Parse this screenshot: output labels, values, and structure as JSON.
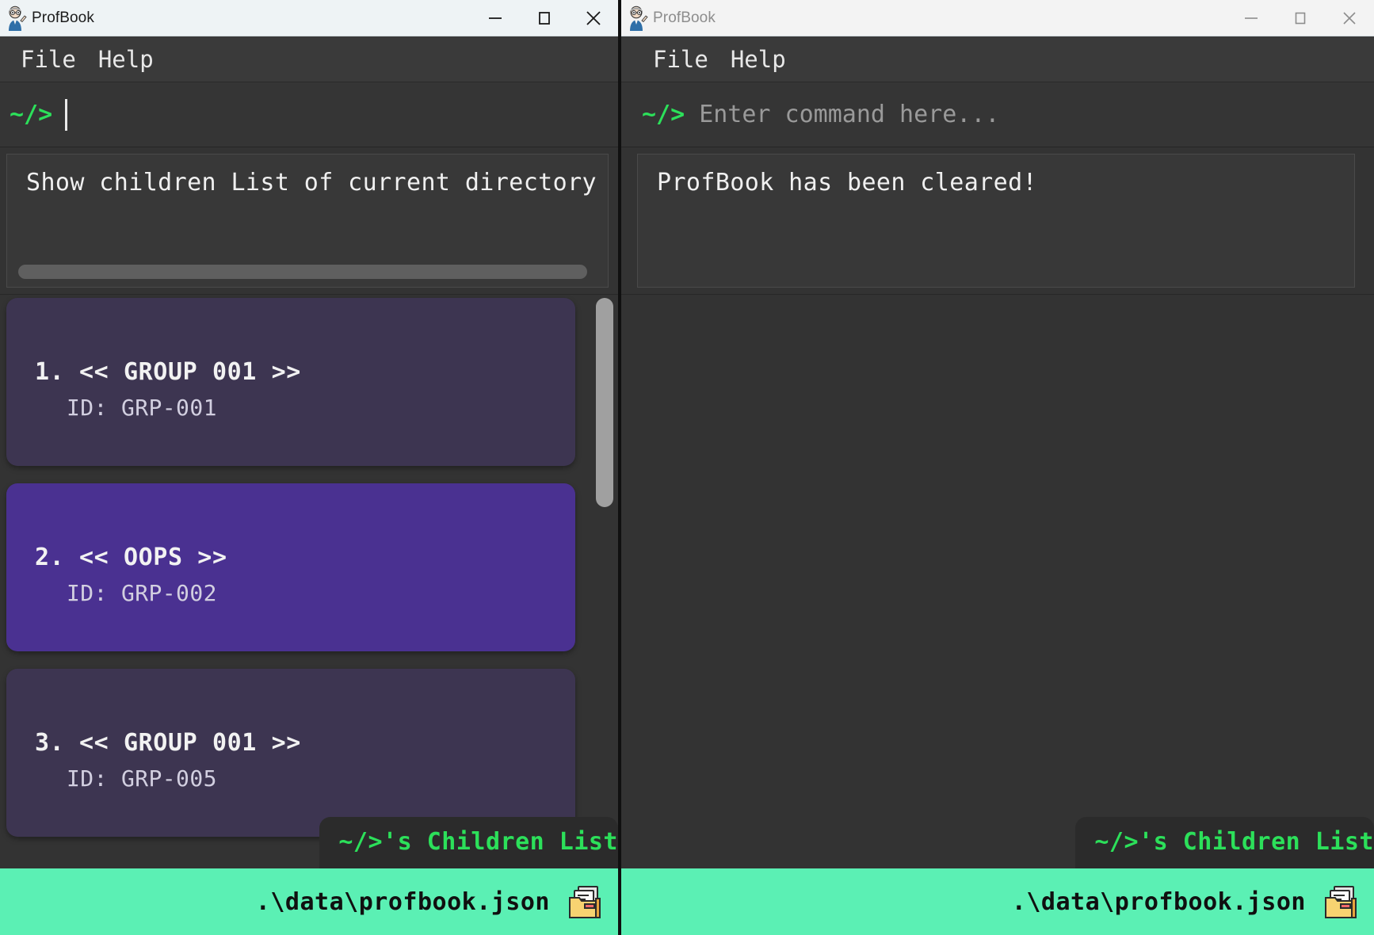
{
  "windows": {
    "left": {
      "title": "ProfBook",
      "active": true,
      "icon": "professor-avatar-icon",
      "caption": {
        "minimize_label": "Minimize",
        "maximize_label": "Maximize",
        "close_label": "Close"
      },
      "menu": [
        {
          "label": "File",
          "name": "menu-file"
        },
        {
          "label": "Help",
          "name": "menu-help"
        }
      ],
      "command": {
        "prompt": "~/>",
        "value": "",
        "placeholder": "",
        "caret_visible": true
      },
      "output": {
        "text": "Show children List of current directory",
        "hscroll_visible": true
      },
      "cards": [
        {
          "title": "1.  << GROUP 001 >>",
          "subtitle": "ID: GRP-001",
          "selected": false
        },
        {
          "title": "2.  << OOPS >>",
          "subtitle": "ID: GRP-002",
          "selected": true
        },
        {
          "title": "3.  << GROUP 001 >>",
          "subtitle": "ID: GRP-005",
          "selected": false
        }
      ],
      "vscroll_visible": true,
      "badge": "~/>'s Children List",
      "status": {
        "path": ".\\data\\profbook.json",
        "icon": "folder-file-icon"
      }
    },
    "right": {
      "title": "ProfBook",
      "active": false,
      "icon": "professor-avatar-icon",
      "caption": {
        "minimize_label": "Minimize",
        "maximize_label": "Maximize",
        "close_label": "Close"
      },
      "menu": [
        {
          "label": "File",
          "name": "menu-file"
        },
        {
          "label": "Help",
          "name": "menu-help"
        }
      ],
      "command": {
        "prompt": "~/>",
        "value": "",
        "placeholder": "Enter command here...",
        "caret_visible": false
      },
      "output": {
        "text": "ProfBook has been cleared!",
        "hscroll_visible": false
      },
      "cards": [],
      "vscroll_visible": false,
      "badge": "~/>'s Children List",
      "status": {
        "path": ".\\data\\profbook.json",
        "icon": "folder-file-icon"
      }
    }
  },
  "colors": {
    "accent_green": "#2ce05a",
    "status_bar": "#5bf0b4",
    "card": "#3d3551",
    "card_selected": "#4a3191",
    "window_bg": "#333333",
    "titlebar_active": "#eef3f5",
    "titlebar_inactive": "#f3f3f3"
  }
}
